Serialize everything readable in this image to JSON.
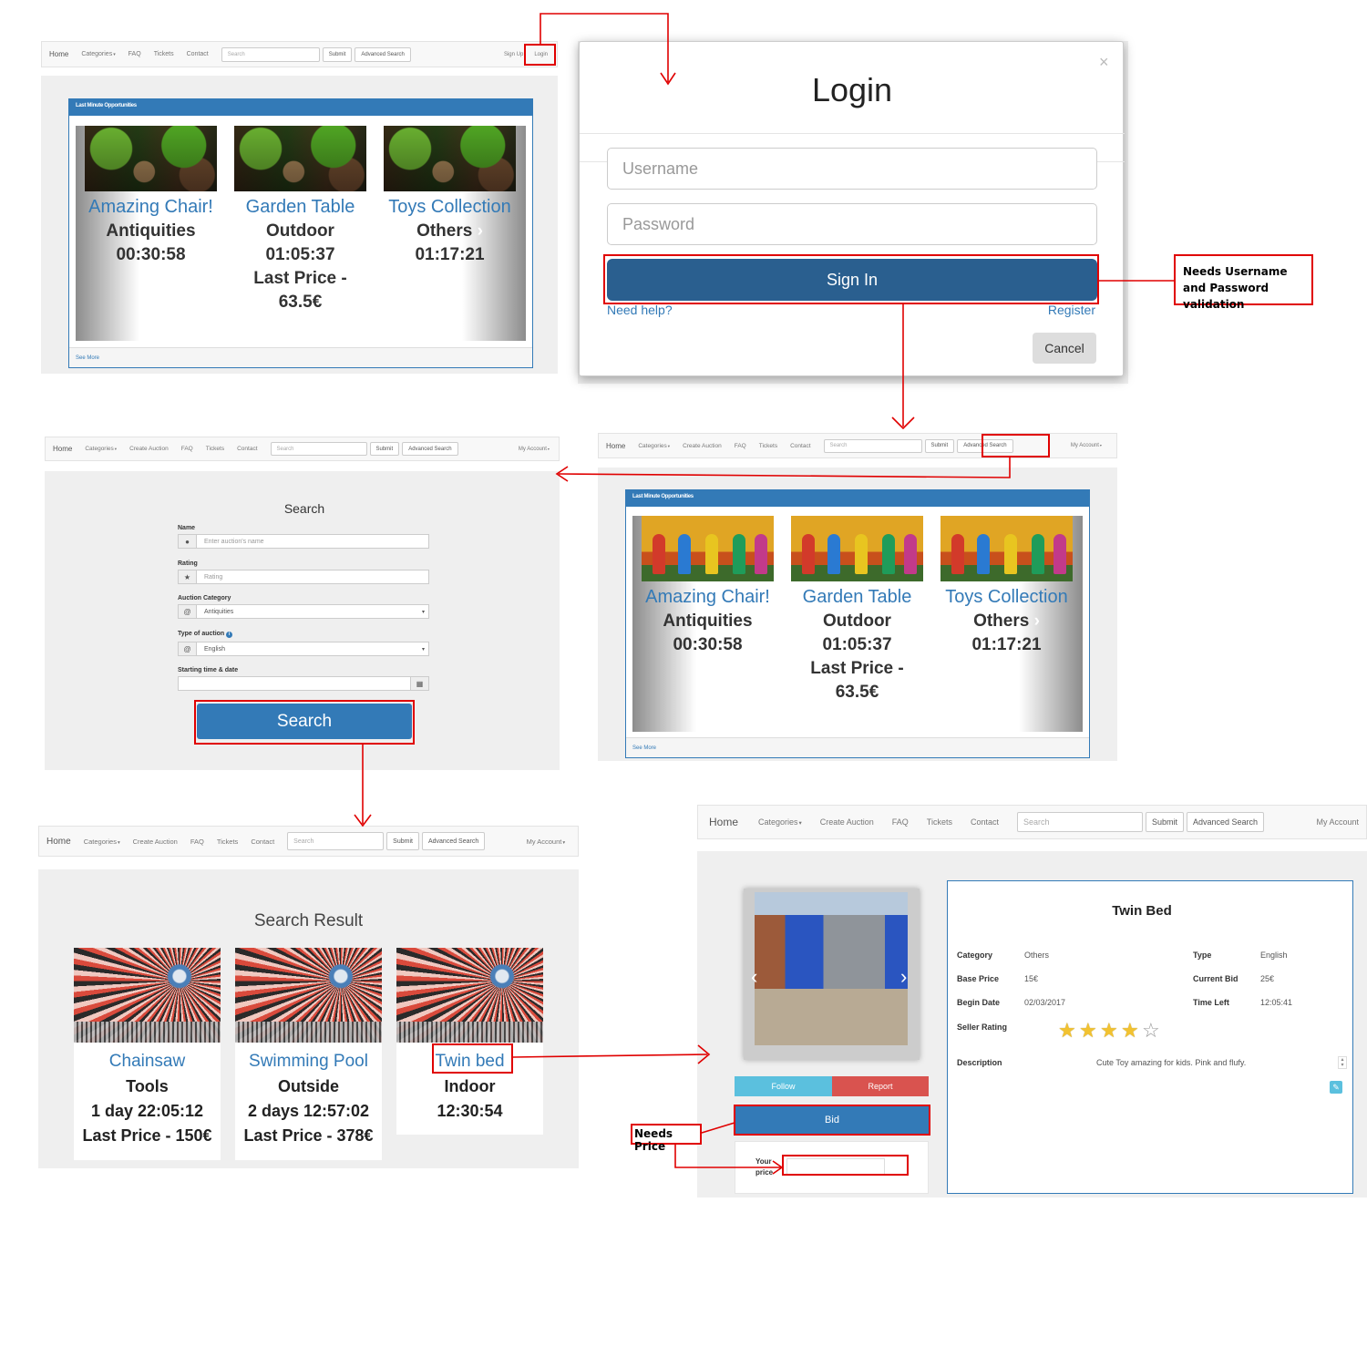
{
  "nav1": {
    "home": "Home",
    "categories": "Categories",
    "faq": "FAQ",
    "tickets": "Tickets",
    "contact": "Contact",
    "search_placeholder": "Search",
    "submit": "Submit",
    "advanced": "Advanced Search",
    "signup": "Sign Up",
    "login": "Login"
  },
  "nav_user": {
    "home": "Home",
    "categories": "Categories",
    "create": "Create Auction",
    "faq": "FAQ",
    "tickets": "Tickets",
    "contact": "Contact",
    "search_placeholder": "Search",
    "submit": "Submit",
    "advanced": "Advanced Search",
    "account": "My Account"
  },
  "opportunities": {
    "header": "Last Minute Opportunities",
    "see_more": "See More",
    "items": [
      {
        "name": "Amazing Chair!",
        "category": "Antiquities",
        "time": "00:30:58",
        "price_line1": "",
        "price_line2": ""
      },
      {
        "name": "Garden Table",
        "category": "Outdoor",
        "time": "01:05:37",
        "price_line1": "Last Price -",
        "price_line2": "63.5€"
      },
      {
        "name": "Toys Collection",
        "category": "Others",
        "time": "01:17:21",
        "price_line1": "",
        "price_line2": ""
      }
    ]
  },
  "login": {
    "close": "×",
    "title": "Login",
    "username_placeholder": "Username",
    "password_placeholder": "Password",
    "sign_in": "Sign In",
    "need_help": "Need help?",
    "register": "Register",
    "cancel": "Cancel"
  },
  "notes": {
    "login_validation": "Needs Username and Password validation",
    "needs_price": "Needs Price"
  },
  "search_form": {
    "title": "Search",
    "name_label": "Name",
    "name_placeholder": "Enter auction's name",
    "rating_label": "Rating",
    "rating_placeholder": "Rating",
    "category_label": "Auction Category",
    "category_value": "Antiquities",
    "type_label": "Type of auction",
    "type_value": "English",
    "date_label": "Starting time & date",
    "button": "Search"
  },
  "results": {
    "title": "Search Result",
    "items": [
      {
        "name": "Chainsaw",
        "category": "Tools",
        "time": "1 day 22:05:12",
        "price": "Last Price - 150€"
      },
      {
        "name": "Swimming Pool",
        "category": "Outside",
        "time": "2 days 12:57:02",
        "price": "Last Price - 378€"
      },
      {
        "name": "Twin bed",
        "category": "Indoor",
        "time": "12:30:54",
        "price": ""
      }
    ]
  },
  "detail": {
    "title": "Twin Bed",
    "category_label": "Category",
    "category": "Others",
    "type_label": "Type",
    "type": "English",
    "base_price_label": "Base Price",
    "base_price": "15€",
    "current_bid_label": "Current Bid",
    "current_bid": "25€",
    "begin_date_label": "Begin Date",
    "begin_date": "02/03/2017",
    "time_left_label": "Time Left",
    "time_left": "12:05:41",
    "seller_rating_label": "Seller Rating",
    "seller_rating": 4,
    "seller_rating_max": 5,
    "description_label": "Description",
    "description": "Cute Toy amazing for kids. Pink and flufy.",
    "follow": "Follow",
    "report": "Report",
    "bid": "Bid",
    "your": "Your",
    "price": "price"
  },
  "colors": {
    "primary": "#337ab7",
    "signin": "#2a5f8f",
    "annotation": "#e00000",
    "follow": "#5bc0de",
    "report": "#d9534f"
  }
}
